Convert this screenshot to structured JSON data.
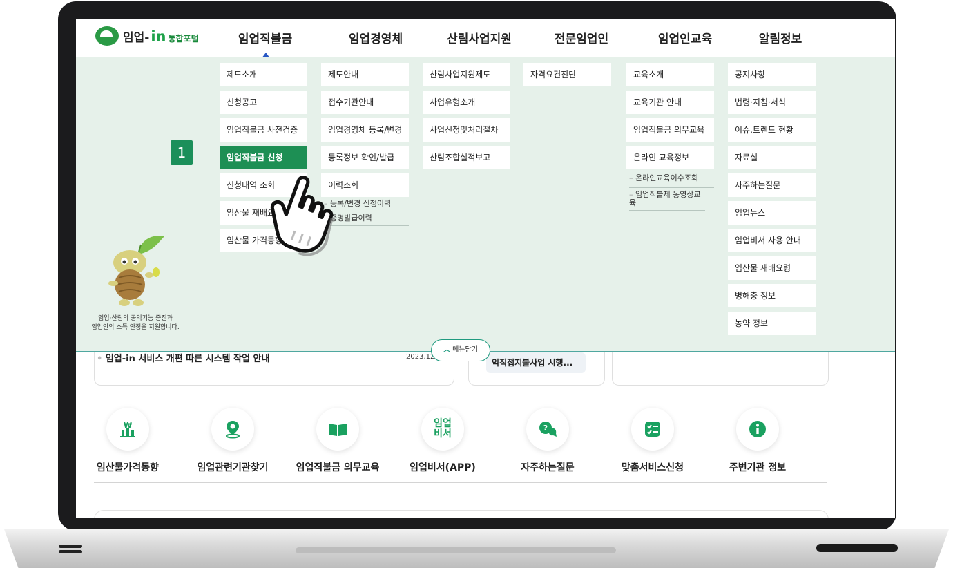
{
  "header": {
    "logo": {
      "prefix": "임업-",
      "in": "in",
      "portal": "통합포털"
    },
    "gnb": [
      "임업직불금",
      "임업경영체",
      "산림사업지원",
      "전문임업인",
      "임업인교육",
      "알림정보"
    ]
  },
  "mega_menu": {
    "col1": [
      "제도소개",
      "신청공고",
      "임업직불금 사전검증",
      "임업직불금 신청",
      "신청내역 조회",
      "임산물 재배요령",
      "임산물 가격동향"
    ],
    "col2": [
      "제도안내",
      "접수기관안내",
      "임업경영체 등록/변경",
      "등록정보 확인/발급",
      "이력조회"
    ],
    "col2_sub": [
      "등록/변경 신청이력",
      "증명발급이력"
    ],
    "col3": [
      "산림사업지원제도",
      "사업유형소개",
      "사업신청및처리절차",
      "산림조합실적보고"
    ],
    "col4": [
      "자격요건진단"
    ],
    "col5": [
      "교육소개",
      "교육기관 안내",
      "임업직불금 의무교육",
      "온라인 교육정보"
    ],
    "col5_sub": [
      "온라인교육이수조회",
      "임업직불제 동영상교육"
    ],
    "col6": [
      "공지사항",
      "법령·지침·서식",
      "이슈,트렌드 현황",
      "자료실",
      "자주하는질문",
      "임업뉴스",
      "임업비서 사용 안내",
      "임산물 재배요령",
      "병해충 정보",
      "농약 정보"
    ],
    "mascot_caption_line1": "임업·산림의 공익기능 증진과",
    "mascot_caption_line2": "임업인의 소득 안정을 지원합니다.",
    "step_badge": "1",
    "close_label": "메뉴닫기"
  },
  "notice": {
    "title": "임업-in 서비스 개편 따른 시스템 작업 안내",
    "date": "2023.12.",
    "card2_text": "익직접지불사업 시행..."
  },
  "quick_menu": [
    {
      "label": "임산물가격동향",
      "icon": "price-chart-icon"
    },
    {
      "label": "임업관련기관찾기",
      "icon": "location-pin-icon"
    },
    {
      "label": "임업직불금 의무교육",
      "icon": "book-icon"
    },
    {
      "label": "임업비서(APP)",
      "icon": "app-text-icon",
      "icon_text": "임업\n비서"
    },
    {
      "label": "자주하는질문",
      "icon": "question-chat-icon"
    },
    {
      "label": "맞춤서비스신청",
      "icon": "checklist-icon"
    },
    {
      "label": "주변기관 정보",
      "icon": "info-icon"
    }
  ],
  "colors": {
    "brand_green": "#1d8f54",
    "menu_bg": "#e6f1ea",
    "icon_green": "#1aa160"
  }
}
